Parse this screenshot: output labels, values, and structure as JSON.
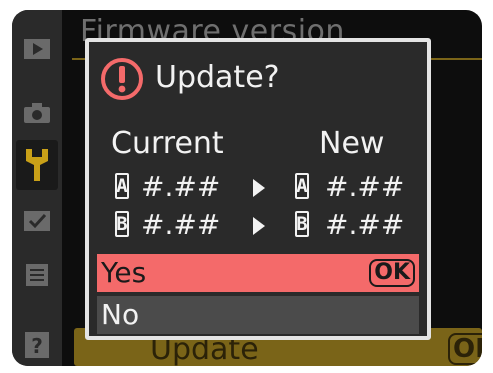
{
  "background": {
    "menu_title": "Firmware version",
    "action_label": "Update",
    "ok_label": "OK"
  },
  "sidebar": {
    "items": [
      {
        "icon": "playback-icon"
      },
      {
        "icon": "camera-icon"
      },
      {
        "icon": "wrench-icon",
        "active": true
      },
      {
        "icon": "retouch-icon"
      },
      {
        "icon": "my-menu-icon"
      },
      {
        "icon": "help-icon",
        "label": "?"
      }
    ]
  },
  "dialog": {
    "title": "Update?",
    "current_header": "Current",
    "new_header": "New",
    "rows": [
      {
        "slot": "A",
        "current": "#.##",
        "new": "#.##"
      },
      {
        "slot": "B",
        "current": "#.##",
        "new": "#.##"
      }
    ],
    "options": {
      "yes_label": "Yes",
      "ok_label": "OK",
      "no_label": "No"
    }
  },
  "colors": {
    "highlight": "#f46a6a",
    "accent_gold": "#7a6418",
    "alert_red": "#f46a6a"
  }
}
